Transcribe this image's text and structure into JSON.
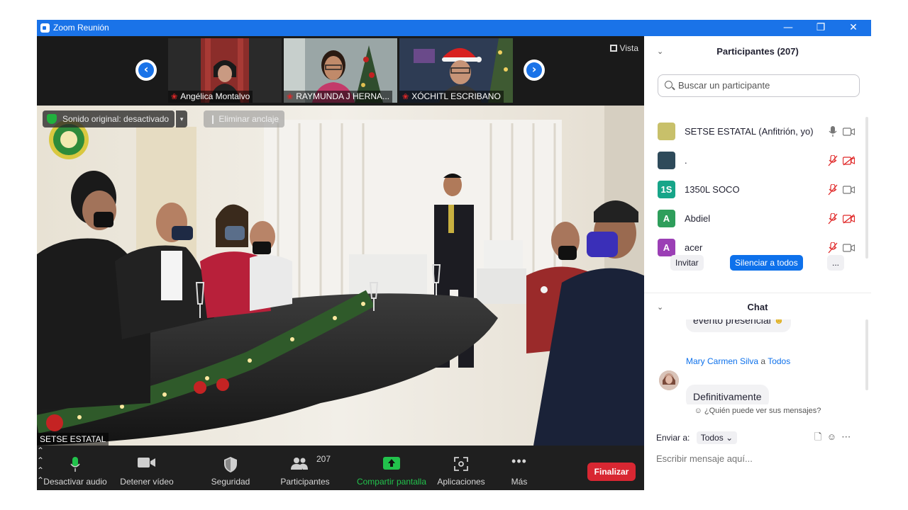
{
  "window": {
    "title": "Zoom Reunión"
  },
  "colors": {
    "accent": "#0e71eb",
    "end": "#d82732",
    "share": "#22c24c",
    "panel_bg": "#ffffff",
    "video_bg": "#1c1c1c"
  },
  "thumbs": [
    {
      "name": "Angélica Montalvo"
    },
    {
      "name": "RAYMUNDA J HERNA..."
    },
    {
      "name": "XÓCHITL ESCRIBANO"
    }
  ],
  "vista": {
    "label": "Vista"
  },
  "main_video": {
    "name_tag": "SETSE ESTATAL",
    "orig_sound": "Sonido original: desactivado",
    "unpin": "Eliminar anclaje"
  },
  "toolbar": {
    "audio": "Desactivar audio",
    "video": "Detener vídeo",
    "security": "Seguridad",
    "participants": "Participantes",
    "participants_count": "207",
    "share": "Compartir pantalla",
    "apps": "Aplicaciones",
    "more": "Más",
    "end": "Finalizar"
  },
  "participants_panel": {
    "title": "Participantes (207)",
    "search_placeholder": "Buscar un participante",
    "items": [
      {
        "name": "SETSE ESTATAL (Anfitrión, yo)",
        "avatar": "",
        "avatar_color": "#c8c06a",
        "mic": "on",
        "cam": "on"
      },
      {
        "name": ".",
        "avatar": "",
        "avatar_color": "#2e4a5a",
        "mic": "off",
        "cam": "off"
      },
      {
        "name": "1350L SOCO",
        "avatar": "1S",
        "avatar_color": "#17a589",
        "mic": "off",
        "cam": "on"
      },
      {
        "name": "Abdiel",
        "avatar": "A",
        "avatar_color": "#2e9e5b",
        "mic": "off",
        "cam": "off"
      },
      {
        "name": "acer",
        "avatar": "A",
        "avatar_color": "#9b3fb5",
        "mic": "off",
        "cam": "on"
      }
    ],
    "invite": "Invitar",
    "mute_all": "Silenciar a todos",
    "more": "..."
  },
  "chat": {
    "title": "Chat",
    "prev_message": "evento presencial",
    "sender": "Mary Carmen Silva",
    "to_word": "a",
    "recipient": "Todos",
    "message": "Definitivamente",
    "who_sees": "¿Quién puede ver sus mensajes?",
    "send_to_label": "Enviar a:",
    "send_to_value": "Todos",
    "input_placeholder": "Escribir mensaje aquí..."
  }
}
